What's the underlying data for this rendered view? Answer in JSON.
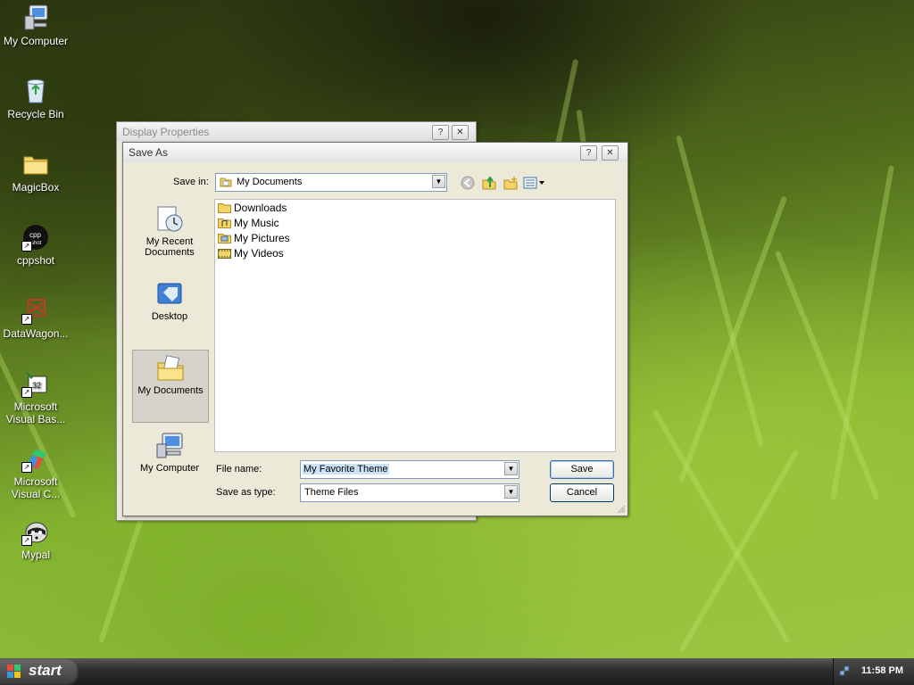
{
  "desktop": {
    "icons": [
      {
        "label": "My Computer"
      },
      {
        "label": "Recycle Bin"
      },
      {
        "label": "MagicBox"
      },
      {
        "label": "cppshot"
      },
      {
        "label": "DataWagon..."
      },
      {
        "label": "Microsoft Visual Bas..."
      },
      {
        "label": "Microsoft Visual C..."
      },
      {
        "label": "Mypal"
      }
    ]
  },
  "display_properties": {
    "title": "Display Properties",
    "help_label": "?",
    "close_label": "✕"
  },
  "save_as": {
    "title": "Save As",
    "help_label": "?",
    "close_label": "✕",
    "save_in_label": "Save in:",
    "save_in_value": "My Documents",
    "places": [
      {
        "label": "My Recent Documents"
      },
      {
        "label": "Desktop"
      },
      {
        "label": "My Documents",
        "selected": true
      },
      {
        "label": "My Computer"
      }
    ],
    "files": [
      {
        "name": "Downloads",
        "icon": "folder-icon"
      },
      {
        "name": "My Music",
        "icon": "music-folder-icon"
      },
      {
        "name": "My Pictures",
        "icon": "pictures-folder-icon"
      },
      {
        "name": "My Videos",
        "icon": "videos-folder-icon"
      }
    ],
    "file_name_label": "File name:",
    "file_name_value": "My Favorite Theme",
    "save_type_label": "Save as type:",
    "save_type_value": "Theme Files",
    "save_button": "Save",
    "cancel_button": "Cancel"
  },
  "taskbar": {
    "start_label": "start",
    "clock": "11:58 PM"
  }
}
